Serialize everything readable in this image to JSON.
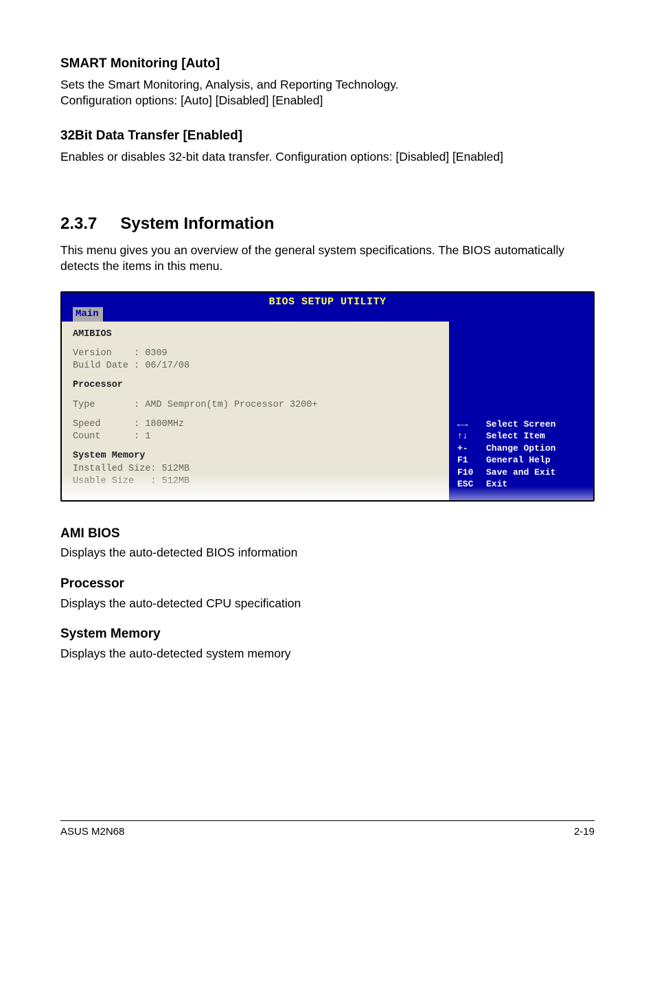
{
  "sections": {
    "smart": {
      "title": "SMART Monitoring [Auto]",
      "p1": "Sets the Smart Monitoring, Analysis, and Reporting Technology.",
      "p2": "Configuration options: [Auto] [Disabled] [Enabled]"
    },
    "transfer": {
      "title": "32Bit Data Transfer [Enabled]",
      "p1": "Enables or disables 32-bit data transfer. Configuration options: [Disabled] [Enabled]"
    },
    "sysinfo": {
      "number": "2.3.7",
      "title": "System Information",
      "intro": "This menu gives you an overview of the general system specifications. The BIOS automatically detects the items in this menu."
    }
  },
  "bios": {
    "header_title": "BIOS SETUP UTILITY",
    "tab": "Main",
    "left": {
      "amibios_label": "AMIBIOS",
      "version_label": "Version",
      "version_value": "0309",
      "build_label": "Build Date",
      "build_value": "06/17/08",
      "processor_label": "Processor",
      "type_label": "Type",
      "type_value": "AMD Sempron(tm) Processor 3200+",
      "speed_label": "Speed",
      "speed_value": "1800MHz",
      "count_label": "Count",
      "count_value": "1",
      "sysmem_label": "System Memory",
      "installed_label": "Installed Size",
      "installed_value": "512MB",
      "usable_label": "Usable Size",
      "usable_value": "512MB"
    },
    "help": [
      {
        "key": "←→",
        "text": "Select Screen"
      },
      {
        "key": "↑↓",
        "text": "Select Item"
      },
      {
        "key": "+-",
        "text": "Change Option"
      },
      {
        "key": "F1",
        "text": "General Help"
      },
      {
        "key": "F10",
        "text": "Save and Exit"
      },
      {
        "key": "ESC",
        "text": "Exit"
      }
    ]
  },
  "post_sections": {
    "ami": {
      "title": "AMI BIOS",
      "text": "Displays the auto-detected BIOS information"
    },
    "processor": {
      "title": "Processor",
      "text": "Displays the auto-detected CPU specification"
    },
    "sysmem": {
      "title": "System Memory",
      "text": "Displays the auto-detected system memory"
    }
  },
  "footer": {
    "left": "ASUS M2N68",
    "right": "2-19"
  }
}
